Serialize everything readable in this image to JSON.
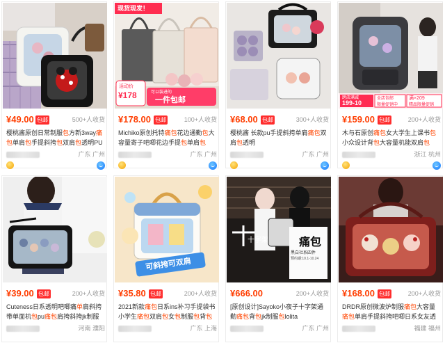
{
  "products": [
    {
      "price": "¥49.00",
      "badge": "包邮",
      "sales": "500+人收货",
      "title_parts": [
        "樱桃酱原创日常制服",
        "包",
        "方新3way",
        "痛包",
        "单肩",
        "包",
        "手提斜挎",
        "包",
        "双肩",
        "包",
        "透明PU"
      ],
      "location": "广东 广州"
    },
    {
      "price": "¥178.00",
      "badge": "包邮",
      "sales": "100+人收货",
      "title_parts": [
        "Michiko原创托特",
        "痛包",
        "花边通勤",
        "包",
        "大容量寄子吧唧花边手提",
        "包",
        "单肩",
        "包"
      ],
      "location": "广东 广州",
      "overlay": {
        "top_tag": "现货现发！",
        "coupon_label": "活动价",
        "coupon_price": "¥178",
        "promo_line1": "可以装进的",
        "promo_line2": "一件包邮"
      }
    },
    {
      "price": "¥68.00",
      "badge": "包邮",
      "sales": "300+人收货",
      "title_parts": [
        "樱桃酱 长款pu手提斜挎单肩",
        "痛包",
        "双肩",
        "包",
        "透明"
      ],
      "location": "广东 广州"
    },
    {
      "price": "¥159.00",
      "badge": "包邮",
      "sales": "200+人收货",
      "title_parts": [
        "木与石原创",
        "痛包",
        "女大学生上课书",
        "包",
        "小众设计背",
        "包",
        "大容量机能双肩",
        "包"
      ],
      "location": "浙江 杭州",
      "overlay": {
        "promo_a": "跨店满减",
        "promo_b": "199-10",
        "promo_c": "全店包邮",
        "promo_d": "限量促销中",
        "promo_e": "满×209",
        "promo_f": "精品限量促销"
      }
    },
    {
      "price": "¥39.00",
      "badge": "包邮",
      "sales": "200+人收货",
      "title_parts": [
        "Cuteness日系透明吧唧痛",
        "单",
        "肩",
        "斜挎带单面机",
        "包",
        "pu",
        "痛包",
        "肩挎斜挎jk制服",
        "包"
      ],
      "location": "河南 濮阳"
    },
    {
      "price": "¥35.80",
      "badge": "包邮",
      "sales": "200+人收货",
      "title_parts": [
        "2021新款",
        "痛包",
        "日系ins补习手提袋书小学生",
        "痛包",
        "双肩",
        "包",
        "女",
        "包",
        "制服",
        "包",
        "背",
        "包"
      ],
      "location": "广东 上海",
      "overlay": {
        "banner": "可斜挎可双肩"
      }
    },
    {
      "price": "¥666.00",
      "badge": "",
      "sales": "200+人收货",
      "title_parts": [
        "[原创设计]Sayoko小夜子十字架通勤",
        "痛包",
        "背",
        "包",
        "jk制服",
        "包",
        "lolita"
      ],
      "location": "广东 广州",
      "overlay": {
        "cross_label": "十字架",
        "big_label": "痛包",
        "sub_label": "黑白社系四件",
        "date": "预约期:10.1-10.24"
      }
    },
    {
      "price": "¥168.00",
      "badge": "包邮",
      "sales": "200+人收货",
      "title_parts": [
        "DRDR原创微波炉制服",
        "痛包",
        "大容量",
        "痛包",
        "单肩手提斜挎吧唧日系女友透明"
      ],
      "location": "福建 福州"
    }
  ],
  "colors": {
    "price": "#ff3d00",
    "badge_bg": "#ff2d2d",
    "highlight_text": "#ff4400",
    "meta_text": "#999999"
  },
  "icons": [
    "medal-icon",
    "wangwang-chat-icon"
  ]
}
